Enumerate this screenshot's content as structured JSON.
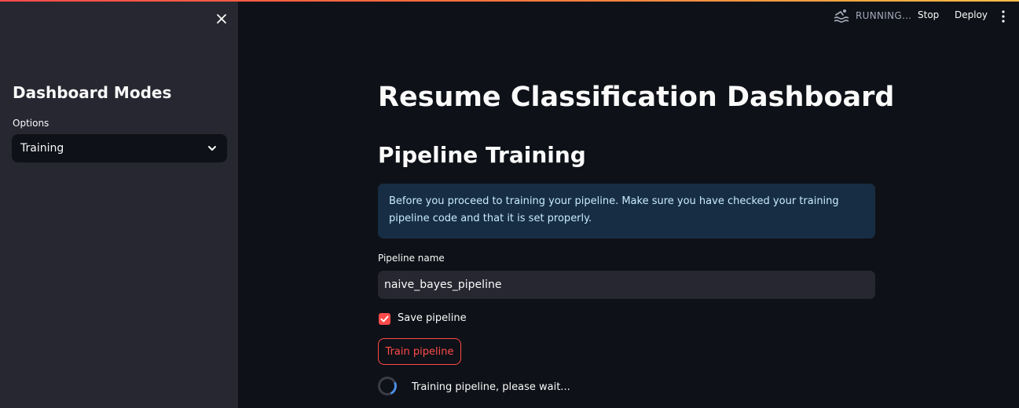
{
  "sidebar": {
    "title": "Dashboard Modes",
    "options_label": "Options",
    "selected_option": "Training"
  },
  "header": {
    "status": "RUNNING...",
    "stop_label": "Stop",
    "deploy_label": "Deploy"
  },
  "main": {
    "title": "Resume Classification Dashboard",
    "subtitle": "Pipeline Training",
    "info_text": "Before you proceed to training your pipeline. Make sure you have checked your training pipeline code and that it is set properly.",
    "pipeline_name_label": "Pipeline name",
    "pipeline_name_value": "naive_bayes_pipeline",
    "save_pipeline_label": "Save pipeline",
    "save_pipeline_checked": true,
    "train_button_label": "Train pipeline",
    "spinner_text": "Training pipeline, please wait..."
  },
  "icons": {
    "close": "close-icon",
    "select_chevron": "chevron-down-icon",
    "running": "swimmer-icon",
    "menu": "kebab-menu-icon",
    "checkbox": "checkmark-icon"
  },
  "colors": {
    "accent": "#ff4b4b",
    "background": "#0e1117",
    "sidebar_background": "#262730",
    "info_background": "#172d43",
    "info_text": "#c7ebff",
    "spinner": "#4d8fe6"
  }
}
